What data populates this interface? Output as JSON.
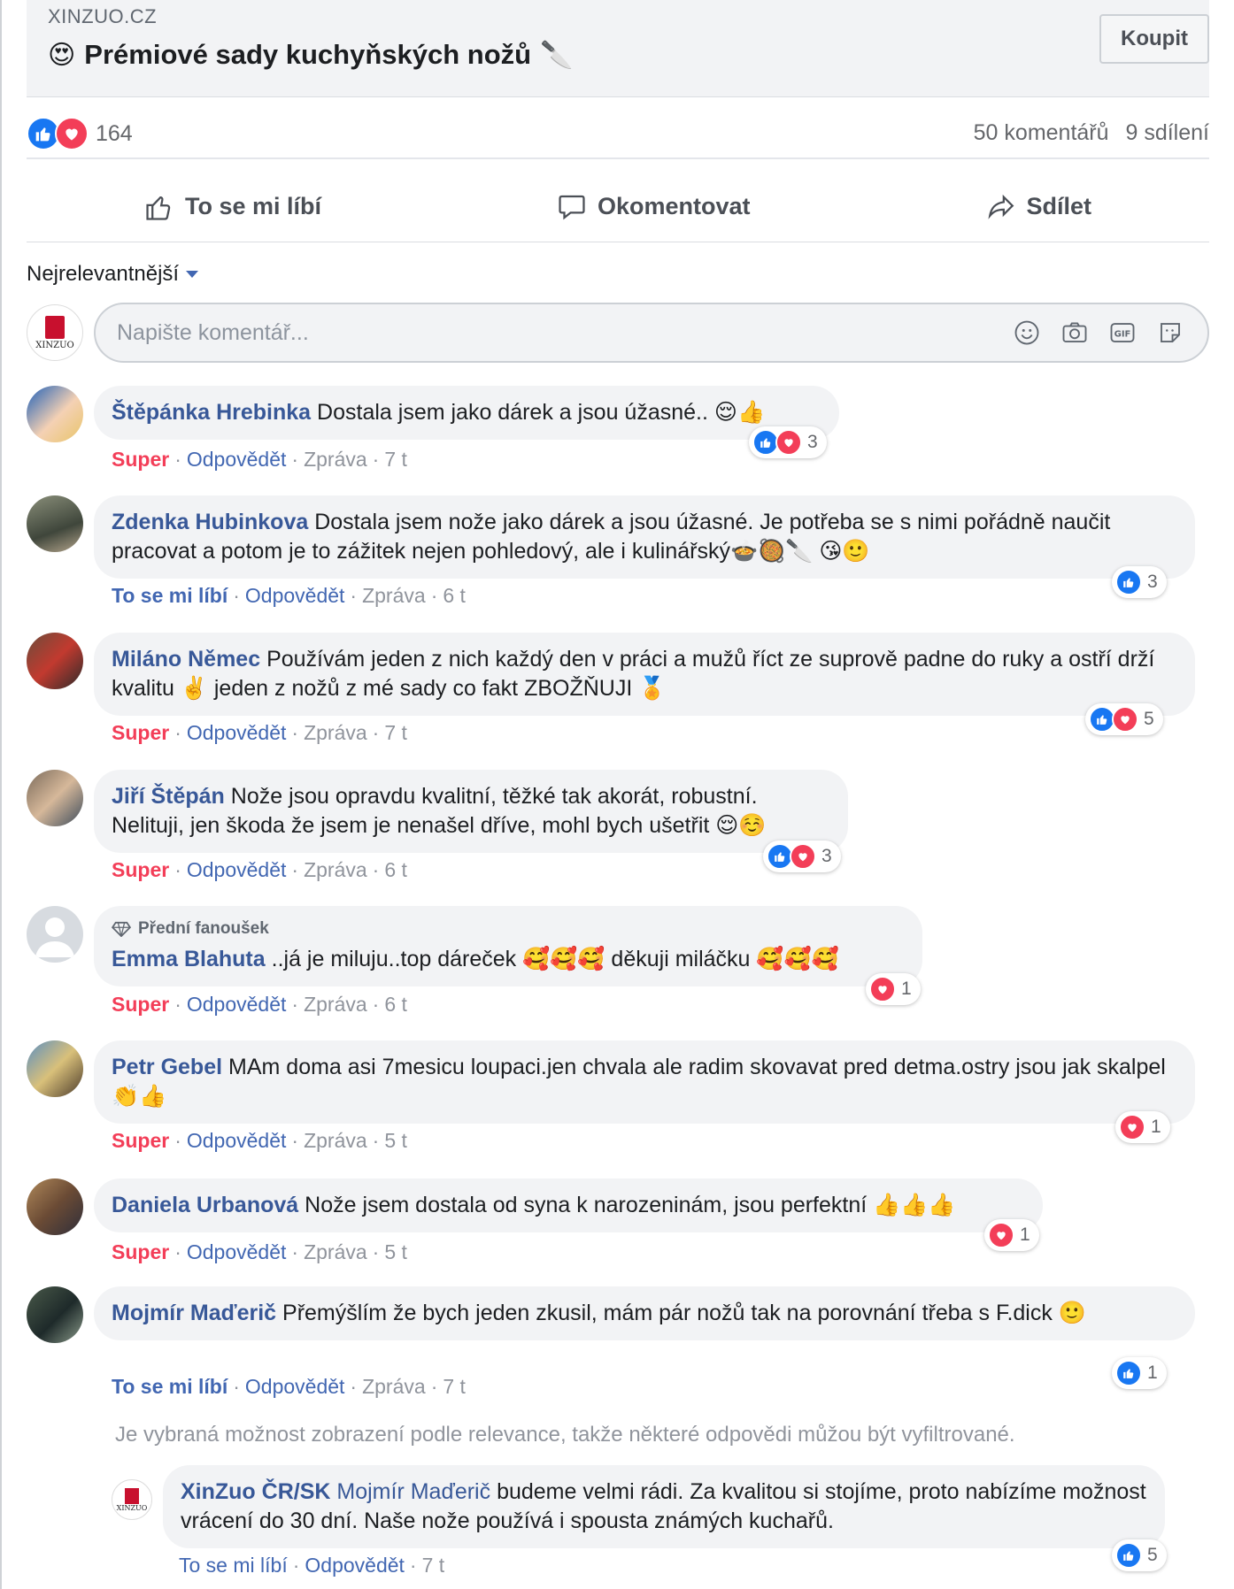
{
  "ad": {
    "domain": "XINZUO.CZ",
    "title_emoji": "😍",
    "title": "Prémiové sady kuchyňských nožů",
    "title_trailing_emoji": "🔪",
    "buy_label": "Koupit"
  },
  "summary": {
    "reaction_count": "164",
    "comments": "50 komentářů",
    "shares": "9 sdílení"
  },
  "actions": {
    "like": "To se mi líbí",
    "comment": "Okomentovat",
    "share": "Sdílet"
  },
  "sort_label": "Nejrelevantnější",
  "composer": {
    "placeholder": "Napište komentář...",
    "page_logo_text": "XINZUO"
  },
  "comments": [
    {
      "author": "Štěpánka Hrebinka",
      "text": "Dostala jsem jako dárek a jsou úžasné.. 😌👍",
      "reaction": "Super",
      "reply": "Odpovědět",
      "message": "Zpráva",
      "time": "7 t",
      "count": "3",
      "rx": [
        "like",
        "love"
      ]
    },
    {
      "author": "Zdenka Hubinkova",
      "text": "Dostala jsem nože jako dárek a jsou úžasné. Je potřeba se s nimi pořádně naučit pracovat a potom je to zážitek nejen pohledový, ale i kulinářský🍲🥘🔪 😘🙂",
      "reaction": "To se mi líbí",
      "reply": "Odpovědět",
      "message": "Zpráva",
      "time": "6 t",
      "count": "3",
      "rx": [
        "like"
      ]
    },
    {
      "author": "Miláno Němec",
      "text": "Používám jeden z nich každý den v práci a mužů říct ze suprově padne do ruky a ostří drží kvalitu ✌️ jeden z nožů z mé sady co fakt ZBOŽŇUJI 🏅",
      "reaction": "Super",
      "reply": "Odpovědět",
      "message": "Zpráva",
      "time": "7 t",
      "count": "5",
      "rx": [
        "like",
        "love"
      ]
    },
    {
      "author": "Jiří Štěpán",
      "text": "Nože jsou opravdu kvalitní, těžké tak akorát, robustní. Nelituji, jen škoda že jsem je nenašel dříve, mohl bych ušetřit 😌☺️",
      "reaction": "Super",
      "reply": "Odpovědět",
      "message": "Zpráva",
      "time": "6 t",
      "count": "3",
      "rx": [
        "like",
        "love"
      ]
    },
    {
      "fan_badge": "Přední fanoušek",
      "author": "Emma Blahuta",
      "text": "..já je miluju..top dáreček 🥰🥰🥰 děkuji miláčku 🥰🥰🥰",
      "reaction": "Super",
      "reply": "Odpovědět",
      "message": "Zpráva",
      "time": "6 t",
      "count": "1",
      "rx": [
        "love"
      ]
    },
    {
      "author": "Petr Gebel",
      "text": "MAm doma asi 7mesicu loupaci.jen chvala ale radim skovavat pred detma.ostry jsou jak skalpel👏👍",
      "reaction": "Super",
      "reply": "Odpovědět",
      "message": "Zpráva",
      "time": "5 t",
      "count": "1",
      "rx": [
        "love"
      ]
    },
    {
      "author": "Daniela Urbanová",
      "text": "Nože jsem dostala od syna k narozeninám, jsou perfektní 👍👍👍",
      "reaction": "Super",
      "reply": "Odpovědět",
      "message": "Zpráva",
      "time": "5 t",
      "count": "1",
      "rx": [
        "love"
      ]
    },
    {
      "author": "Mojmír Maďerič",
      "text": "Přemýšlím že bych jeden zkusil, mám pár nožů tak na porovnání třeba s F.dick 🙂",
      "reaction": "To se mi líbí",
      "reply": "Odpovědět",
      "message": "Zpráva",
      "time": "7 t",
      "count": "1",
      "rx": [
        "like"
      ]
    }
  ],
  "filter_notice": "Je vybraná možnost zobrazení podle relevance, takže některé odpovědi můžou být vyfiltrované.",
  "reply": {
    "author": "XinZuo ČR/SK",
    "tagged": "Mojmír Maďerič",
    "text": "budeme velmi rádi. Za kvalitou si stojíme, proto nabízíme možnost vrácení do 30 dní. Naše nože používá i spousta známých kuchařů.",
    "reaction": "To se mi líbí",
    "reply_label": "Odpovědět",
    "time": "7 t",
    "count": "5"
  },
  "colors": {
    "link": "#385898",
    "like_blue": "#1877f2",
    "love_red": "#f33e58",
    "action_blue": "#4267b2"
  }
}
